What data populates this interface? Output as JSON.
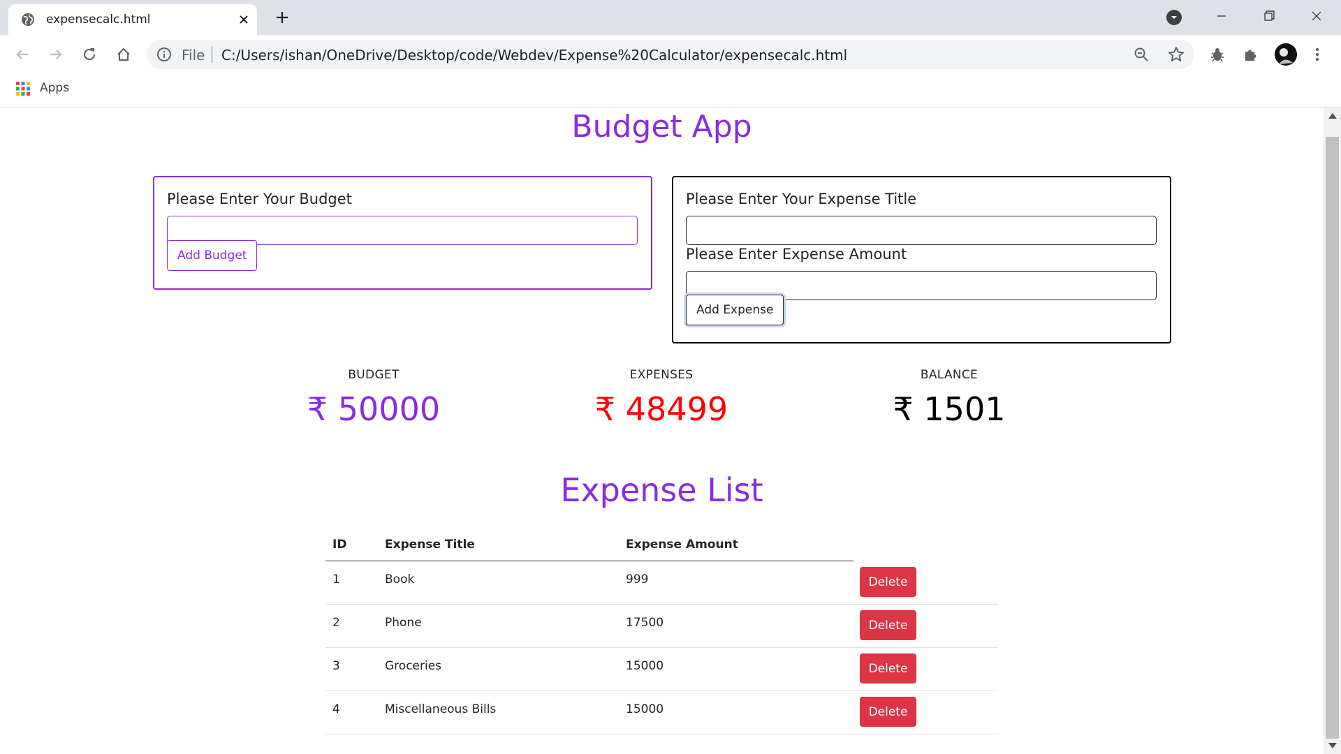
{
  "browser": {
    "tab_title": "expensecalc.html",
    "omnibox_scheme": "File",
    "url": "C:/Users/ishan/OneDrive/Desktop/code/Webdev/Expense%20Calculator/expensecalc.html",
    "bookmarks_apps_label": "Apps"
  },
  "app": {
    "title": "Budget App",
    "budget_card": {
      "label": "Please Enter Your Budget",
      "input_value": "",
      "button_label": "Add Budget"
    },
    "expense_card": {
      "title_label": "Please Enter Your Expense Title",
      "title_value": "",
      "amount_label": "Please Enter Expense Amount",
      "amount_value": "",
      "button_label": "Add Expense"
    },
    "summary": {
      "budget_label": "BUDGET",
      "budget_value": "₹ 50000",
      "expenses_label": "EXPENSES",
      "expenses_value": "₹ 48499",
      "balance_label": "BALANCE",
      "balance_value": "₹ 1501"
    },
    "list_title": "Expense List",
    "table": {
      "headers": [
        "ID",
        "Expense Title",
        "Expense Amount"
      ],
      "rows": [
        {
          "id": "1",
          "title": "Book",
          "amount": "999",
          "action": "Delete"
        },
        {
          "id": "2",
          "title": "Phone",
          "amount": "17500",
          "action": "Delete"
        },
        {
          "id": "3",
          "title": "Groceries",
          "amount": "15000",
          "action": "Delete"
        },
        {
          "id": "4",
          "title": "Miscellaneous Bills",
          "amount": "15000",
          "action": "Delete"
        }
      ]
    }
  },
  "colors": {
    "accent": "#8a2be2",
    "expense_red": "#ff0000",
    "delete_red": "#dc3545"
  }
}
